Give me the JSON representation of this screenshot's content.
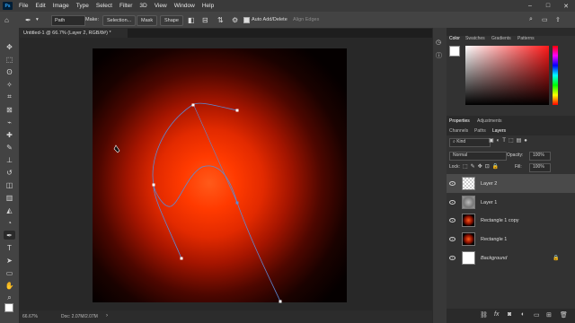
{
  "menu": {
    "items": [
      "File",
      "Edit",
      "Image",
      "Type",
      "Select",
      "Filter",
      "3D",
      "View",
      "Window",
      "Help"
    ],
    "window_controls": [
      "–",
      "□",
      "✕"
    ]
  },
  "options_bar": {
    "mode": "Path",
    "make_label": "Make:",
    "selection_btn": "Selection...",
    "mask_btn": "Mask",
    "shape_btn": "Shape",
    "auto_add_delete": "Auto Add/Delete",
    "align_edges": "Align Edges"
  },
  "document": {
    "tab_title": "Untitled-1 @ 66.7% (Layer 2, RGB/8#) *",
    "zoom": "66.67%",
    "doc_info": "Doc: 2.07M/2.07M"
  },
  "color_panel": {
    "tabs": [
      "Color",
      "Swatches",
      "Gradients",
      "Patterns"
    ],
    "hue_color": "#ff1a1a"
  },
  "properties_panel": {
    "tabs": [
      "Properties",
      "Adjustments"
    ]
  },
  "layers_panel": {
    "tabs": [
      "Channels",
      "Paths",
      "Layers"
    ],
    "kind_label": "Kind",
    "blend_mode": "Normal",
    "opacity_label": "Opacity:",
    "opacity_value": "100%",
    "lock_label": "Lock:",
    "fill_label": "Fill:",
    "fill_value": "100%",
    "layers": [
      {
        "name": "Layer 2",
        "selected": true,
        "italic": false,
        "thumb": "transparent"
      },
      {
        "name": "Layer 1",
        "selected": false,
        "italic": false,
        "thumb": "cloud"
      },
      {
        "name": "Rectangle 1 copy",
        "selected": false,
        "italic": false,
        "thumb": "glow"
      },
      {
        "name": "Rectangle 1",
        "selected": false,
        "italic": false,
        "thumb": "glow"
      },
      {
        "name": "Background",
        "selected": false,
        "italic": true,
        "thumb": "white"
      }
    ],
    "footer_icons": [
      "link-icon",
      "fx-icon",
      "mask-icon",
      "adjustment-icon",
      "group-icon",
      "new-layer-icon",
      "trash-icon"
    ]
  }
}
